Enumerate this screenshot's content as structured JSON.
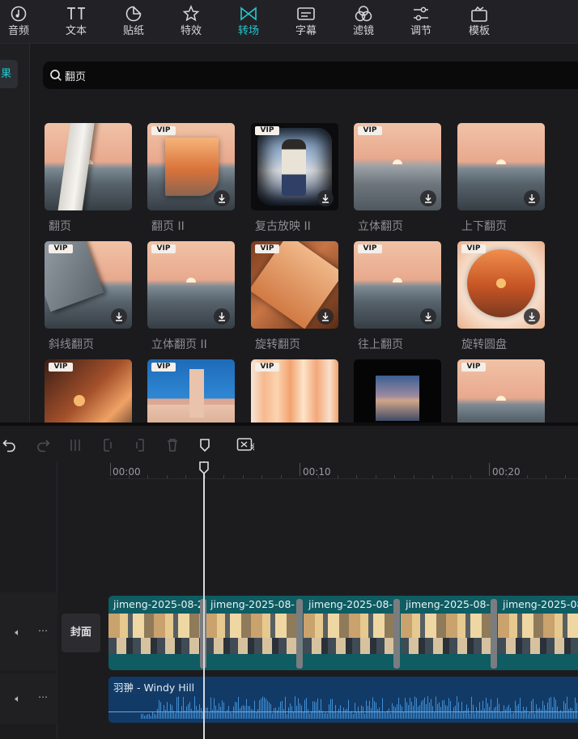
{
  "toolbar": {
    "tabs": [
      {
        "label": "音频",
        "icon": "audio-icon"
      },
      {
        "label": "文本",
        "icon": "text-icon"
      },
      {
        "label": "贴纸",
        "icon": "sticker-icon"
      },
      {
        "label": "特效",
        "icon": "effects-icon"
      },
      {
        "label": "转场",
        "icon": "transition-icon",
        "active": true
      },
      {
        "label": "字幕",
        "icon": "subtitle-icon"
      },
      {
        "label": "滤镜",
        "icon": "filter-icon"
      },
      {
        "label": "调节",
        "icon": "adjust-icon"
      },
      {
        "label": "模板",
        "icon": "template-icon"
      }
    ]
  },
  "sidebar": {
    "active_tab_fragment": "果"
  },
  "search": {
    "value": "翻页"
  },
  "badges": {
    "vip": "VIP"
  },
  "results": [
    {
      "name": "翻页",
      "vip": false,
      "download": false
    },
    {
      "name": "翻页 II",
      "vip": true,
      "download": true
    },
    {
      "name": "复古放映 II",
      "vip": true,
      "download": true
    },
    {
      "name": "立体翻页",
      "vip": true,
      "download": true
    },
    {
      "name": "上下翻页",
      "vip": false,
      "download": true
    },
    {
      "name": "斜线翻页",
      "vip": true,
      "download": true
    },
    {
      "name": "立体翻页 II",
      "vip": true,
      "download": true
    },
    {
      "name": "旋转翻页",
      "vip": true,
      "download": true
    },
    {
      "name": "往上翻页",
      "vip": true,
      "download": true
    },
    {
      "name": "旋转圆盘",
      "vip": true,
      "download": true
    },
    {
      "name": "",
      "vip": true,
      "download": false
    },
    {
      "name": "",
      "vip": true,
      "download": false
    },
    {
      "name": "",
      "vip": true,
      "download": false
    },
    {
      "name": "",
      "vip": false,
      "download": false
    },
    {
      "name": "",
      "vip": true,
      "download": false
    }
  ],
  "timeline": {
    "ruler": [
      "00:00",
      "00:10",
      "00:20"
    ],
    "cover_label": "封面",
    "video_clips": [
      "jimeng-2025-08-2",
      "jimeng-2025-08-",
      "jimeng-2025-08-",
      "jimeng-2025-08-",
      "jimeng-2025-08-"
    ],
    "audio_title": "羽翀 - Windy Hill"
  },
  "colors": {
    "accent": "#22c8d0",
    "video_track": "#0f5c62",
    "audio_track": "#123a66"
  }
}
